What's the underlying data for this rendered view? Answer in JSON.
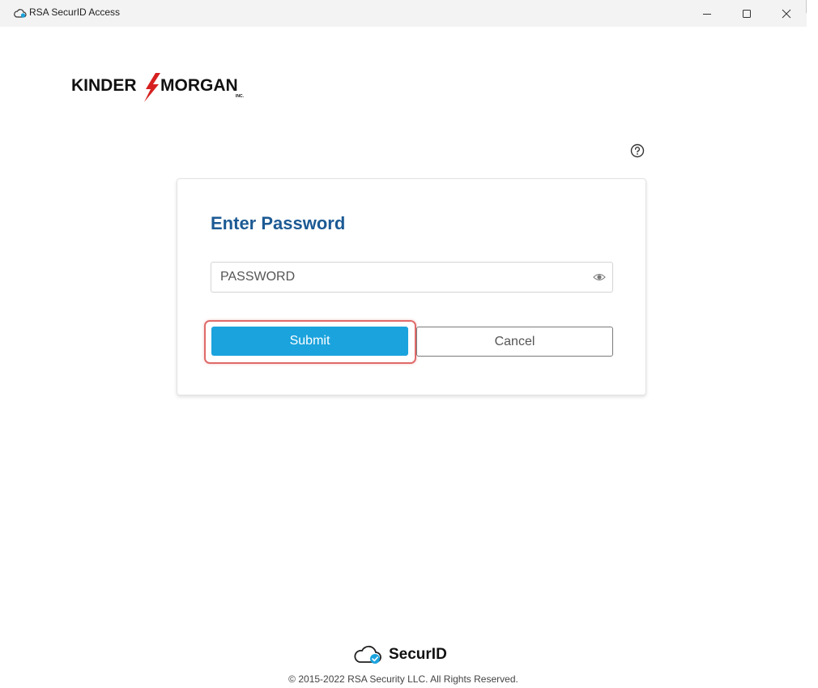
{
  "window": {
    "title": "RSA SecurID Access",
    "app_icon": "cloud-icon",
    "controls": {
      "minimize": "minimize-icon",
      "maximize": "maximize-icon",
      "close": "close-icon"
    }
  },
  "logo": {
    "left_text": "KINDER",
    "right_text": "MORGAN",
    "suffix": "INC."
  },
  "help": {
    "icon": "help-circle-icon"
  },
  "login": {
    "title": "Enter Password",
    "password_placeholder": "PASSWORD",
    "password_value": "",
    "toggle_icon": "eye-icon",
    "submit_label": "Submit",
    "cancel_label": "Cancel"
  },
  "footer": {
    "brand": "SecurID",
    "copyright": "© 2015-2022 RSA Security LLC. All Rights Reserved."
  },
  "colors": {
    "title_blue": "#1c5a94",
    "submit_blue": "#1ba3dd",
    "highlight_red": "#e06a6a",
    "logo_red": "#d62020"
  }
}
